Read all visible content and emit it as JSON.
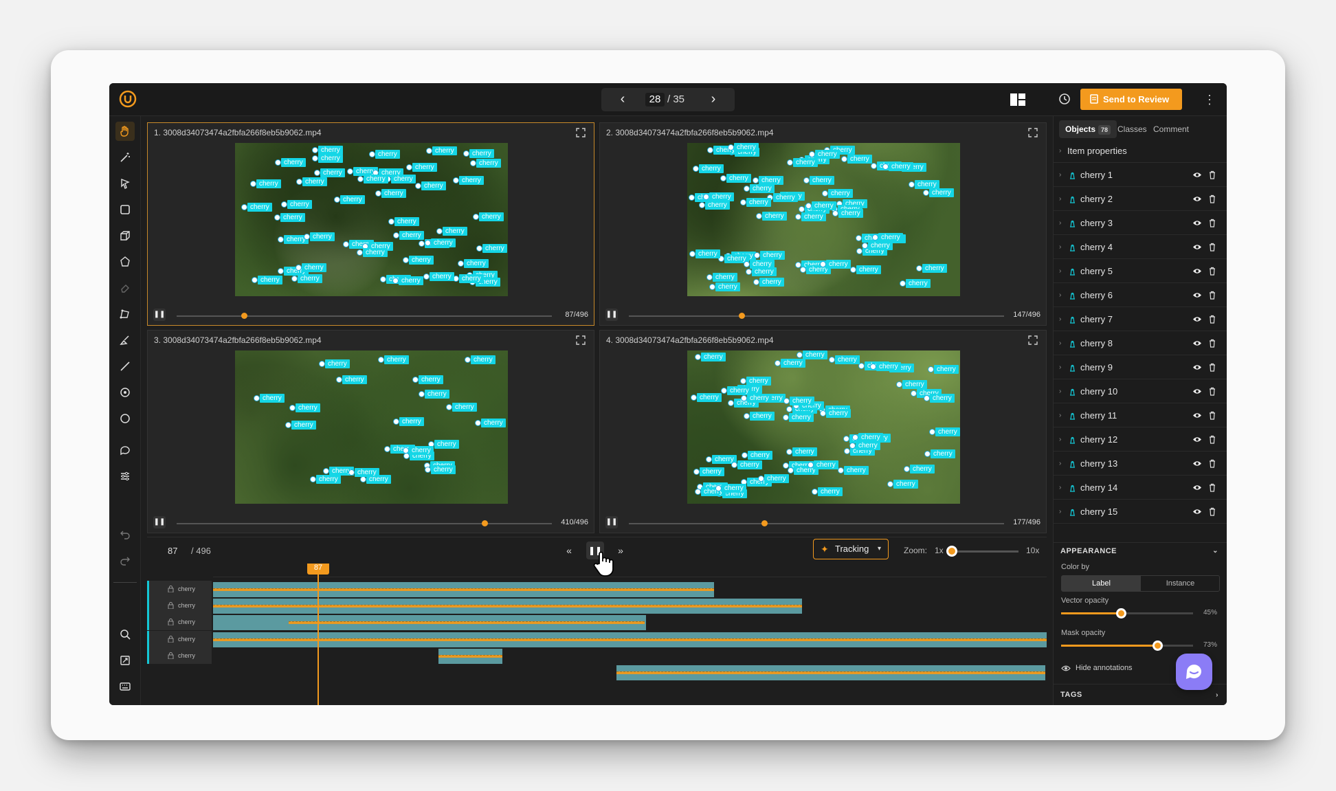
{
  "pager": {
    "current": "28",
    "total": "/ 35"
  },
  "header": {
    "review_label": "Send to Review"
  },
  "panels": [
    {
      "title": "1. 3008d34073474a2fbfa266f8eb5b9062.mp4",
      "frame": "87/496",
      "progress": 0.18
    },
    {
      "title": "2. 3008d34073474a2fbfa266f8eb5b9062.mp4",
      "frame": "147/496",
      "progress": 0.3
    },
    {
      "title": "3. 3008d34073474a2fbfa266f8eb5b9062.mp4",
      "frame": "410/496",
      "progress": 0.82
    },
    {
      "title": "4. 3008d34073474a2fbfa266f8eb5b9062.mp4",
      "frame": "177/496",
      "progress": 0.36
    }
  ],
  "video_label": "cherry",
  "timeline": {
    "frame": "87",
    "total": "/ 496",
    "playhead": "87",
    "tracking_label": "Tracking",
    "zoom_label": "Zoom:",
    "zoom_min": "1x",
    "zoom_max": "10x",
    "rows": [
      "cherry",
      "cherry",
      "cherry",
      "cherry",
      "cherry"
    ]
  },
  "sidebar": {
    "tabs": [
      {
        "label": "Objects",
        "count": "78"
      },
      {
        "label": "Classes"
      },
      {
        "label": "Comment"
      }
    ],
    "item_properties": "Item properties",
    "objects": [
      "cherry 1",
      "cherry 2",
      "cherry 3",
      "cherry 4",
      "cherry 5",
      "cherry 6",
      "cherry 7",
      "cherry 8",
      "cherry 9",
      "cherry 10",
      "cherry 11",
      "cherry 12",
      "cherry 13",
      "cherry 14",
      "cherry 15"
    ],
    "appearance": {
      "title": "APPEARANCE",
      "color_by": "Color by",
      "options": [
        "Label",
        "Instance"
      ],
      "selected": "Label",
      "vector_opacity_label": "Vector opacity",
      "vector_opacity": "45%",
      "mask_opacity_label": "Mask opacity",
      "mask_opacity": "73%",
      "hide_annotations": "Hide annotations"
    },
    "tags_title": "TAGS"
  },
  "colors": {
    "accent": "#f39a1e",
    "label": "#14d6e6",
    "track": "#5b9aa0"
  }
}
